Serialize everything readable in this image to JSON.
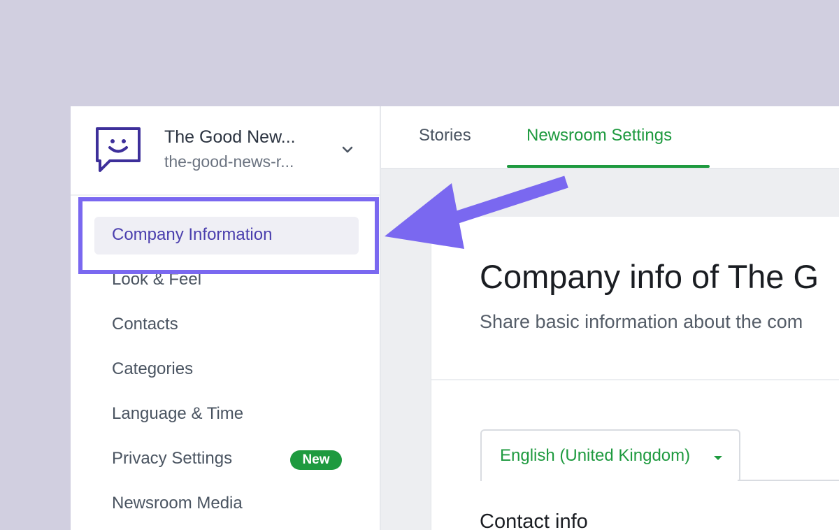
{
  "brand": {
    "name": "The Good New...",
    "url": "the-good-news-r..."
  },
  "sidebar": {
    "items": [
      {
        "label": "Company Information",
        "active": true
      },
      {
        "label": "Look & Feel"
      },
      {
        "label": "Contacts"
      },
      {
        "label": "Categories"
      },
      {
        "label": "Language & Time"
      },
      {
        "label": "Privacy Settings",
        "badge": "New"
      },
      {
        "label": "Newsroom Media"
      }
    ]
  },
  "tabs": {
    "stories": "Stories",
    "settings": "Newsroom Settings"
  },
  "main": {
    "title": "Company info of The G",
    "subtitle": "Share basic information about the com",
    "language": "English (United Kingdom)",
    "section_title": "Contact info"
  },
  "colors": {
    "background": "#d1cfe0",
    "accent_green": "#1e9a3f",
    "highlight_purple": "#7a68f0",
    "active_nav_text": "#4b3fae"
  },
  "icons": {
    "logo": "smiley-chat-bubble-icon",
    "dropdown": "chevron-down-icon",
    "language_caret": "caret-down-icon"
  }
}
